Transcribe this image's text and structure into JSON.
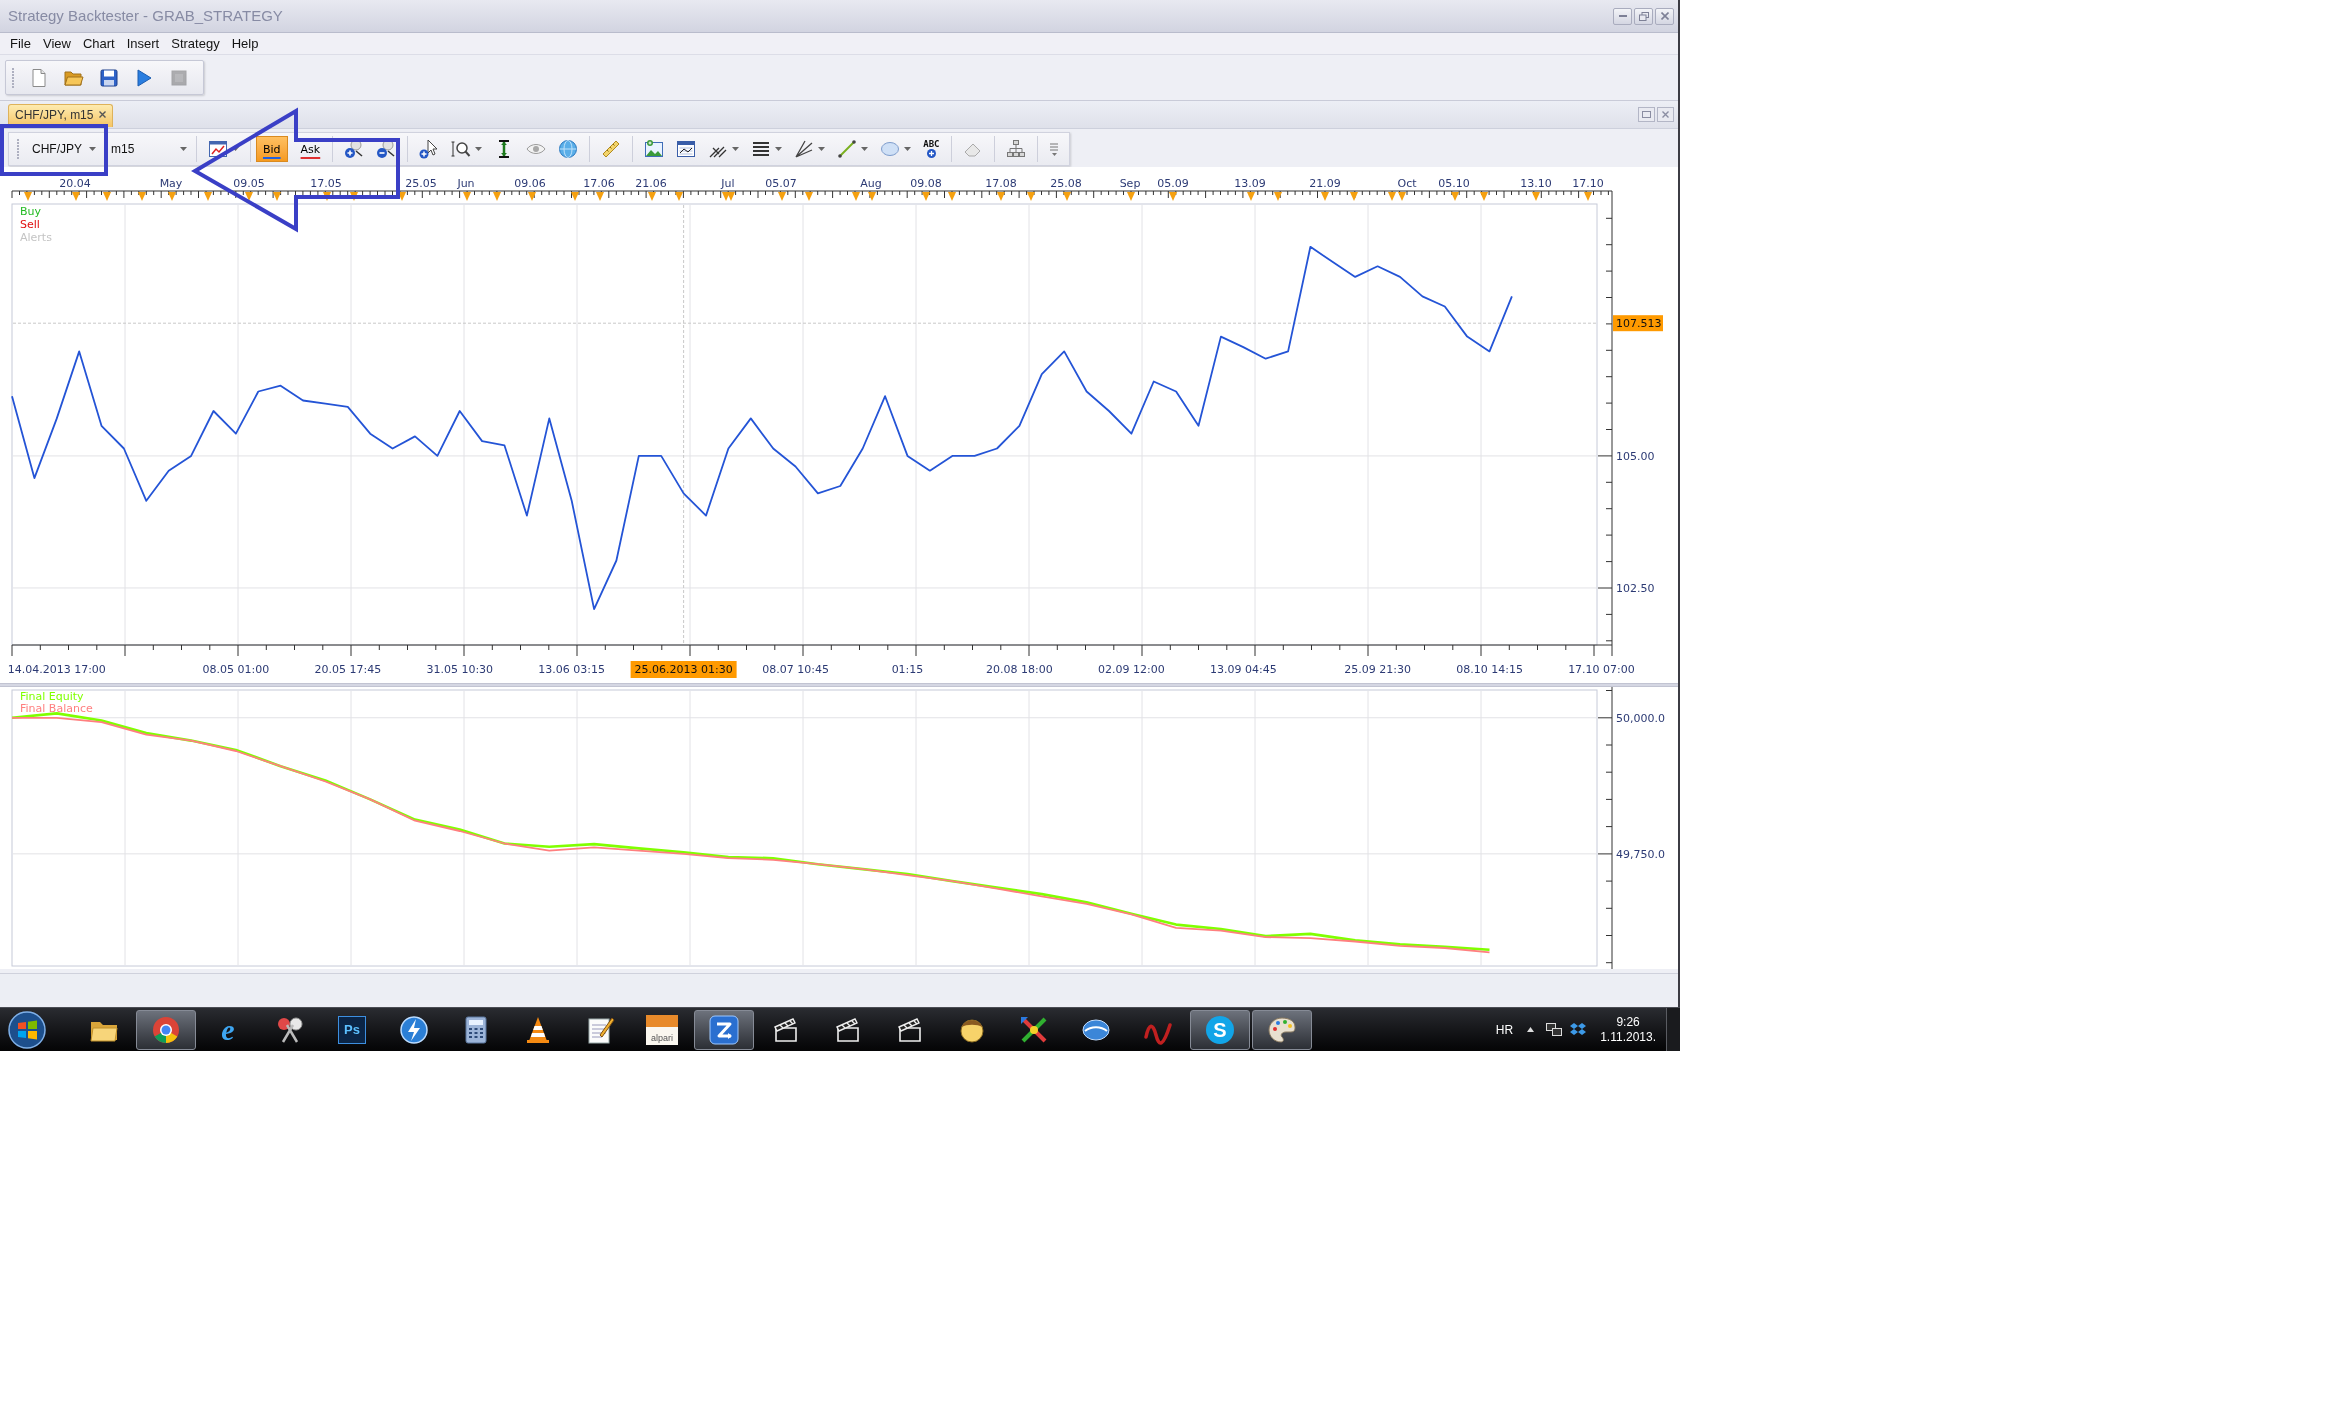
{
  "window": {
    "title": "Strategy Backtester - GRAB_STRATEGY"
  },
  "menu": [
    "File",
    "View",
    "Chart",
    "Insert",
    "Strategy",
    "Help"
  ],
  "toolbar": [
    {
      "kind": "new",
      "disabled": false
    },
    {
      "kind": "open",
      "disabled": false
    },
    {
      "kind": "save",
      "disabled": false
    },
    {
      "kind": "run",
      "disabled": false
    },
    {
      "kind": "stop",
      "disabled": true
    }
  ],
  "document_tab": {
    "label": "CHF/JPY, m15"
  },
  "chart_toolbar": {
    "symbol": "CHF/JPY",
    "period": "m15",
    "price_modes": [
      {
        "label": "Bid",
        "selected": true
      },
      {
        "label": "Ask",
        "selected": false
      }
    ],
    "text_tool": "ABC"
  },
  "price_chart": {
    "top_axis": [
      "20.04",
      "May",
      "09.05",
      "17.05",
      "25.05",
      "Jun",
      "09.06",
      "17.06",
      "21.06",
      "Jul",
      "05.07",
      "Aug",
      "09.08",
      "17.08",
      "25.08",
      "Sep",
      "05.09",
      "13.09",
      "21.09",
      "Oct",
      "05.10",
      "13.10",
      "17.10"
    ],
    "legend": [
      {
        "label": "Buy",
        "color": "#22bb22"
      },
      {
        "label": "Sell",
        "color": "#e01010"
      },
      {
        "label": "Alerts",
        "color": "#c4c4c4"
      }
    ],
    "chart_data": {
      "type": "line",
      "categories": [
        null,
        null,
        "14.04.2013 17:00",
        null,
        null,
        null,
        null,
        null,
        null,
        null,
        "08.05 01:00",
        null,
        null,
        null,
        null,
        "20.05 17:45",
        null,
        null,
        null,
        null,
        "31.05 10:30",
        null,
        null,
        null,
        null,
        "13.06 03:15",
        null,
        null,
        null,
        null,
        "25.06.2013 01:30",
        null,
        null,
        null,
        null,
        "08.07 10:45",
        null,
        null,
        null,
        null,
        "01:15",
        null,
        null,
        null,
        null,
        "20.08 18:00",
        null,
        null,
        null,
        null,
        "02.09 12:00",
        null,
        null,
        null,
        null,
        "13.09 04:45",
        null,
        null,
        null,
        null,
        null,
        "25.09 21:30",
        null,
        null,
        null,
        null,
        "08.10 14:15",
        null,
        null,
        null,
        null,
        "17.10 07:00"
      ],
      "values": [
        106.13,
        104.58,
        105.71,
        106.98,
        105.57,
        105.14,
        104.15,
        104.72,
        105,
        105.85,
        105.42,
        106.22,
        106.33,
        106.05,
        105.99,
        105.93,
        105.42,
        105.14,
        105.37,
        105,
        105.85,
        105.28,
        105.2,
        103.87,
        105.71,
        104.15,
        102.1,
        103.02,
        105,
        105,
        104.29,
        103.87,
        105.14,
        105.71,
        105.14,
        104.8,
        104.29,
        104.43,
        105.14,
        106.13,
        105,
        104.72,
        105,
        105,
        105.14,
        105.57,
        106.55,
        106.98,
        106.22,
        105.85,
        105.42,
        106.41,
        106.22,
        105.57,
        107.26,
        107.06,
        106.84,
        106.98,
        108.96,
        108.67,
        108.39,
        108.59,
        108.39,
        108.02,
        107.83,
        107.26,
        106.98,
        108.02,
        null,
        null,
        null,
        null
      ],
      "ylim": [
        101.42,
        109.77
      ],
      "yticks": [
        {
          "value": 102.5,
          "label": "102.50"
        },
        {
          "value": 105,
          "label": "105.00"
        }
      ],
      "grid": true,
      "ref_lines": [
        {
          "axis": "y",
          "value": 107.513,
          "label": "107.513"
        },
        {
          "axis": "x",
          "value": "25.06.2013 01:30"
        }
      ]
    }
  },
  "equity_chart": {
    "chart_data": {
      "type": "line",
      "categories": [
        null,
        null,
        null,
        null,
        null,
        null,
        null,
        null,
        null,
        null,
        null,
        null,
        null,
        null,
        null,
        null,
        null,
        null,
        null,
        null,
        null,
        null,
        null,
        null,
        null,
        null,
        null,
        null,
        null,
        null,
        null,
        null,
        null,
        null,
        null,
        null
      ],
      "series": [
        {
          "name": "Final Equity",
          "color": "#80ff00",
          "values": [
            50000,
            50008,
            49995,
            49972,
            49958,
            49941,
            49911,
            49885,
            49850,
            49813,
            49795,
            49769,
            49763,
            49768,
            49760,
            49753,
            49744,
            49742,
            49731,
            49722,
            49713,
            49700,
            49688,
            49676,
            49661,
            49640,
            49620,
            49612,
            49599,
            49603,
            49591,
            49584,
            49579,
            49574,
            null,
            null
          ]
        },
        {
          "name": "Final Balance",
          "color": "#ff7f7f",
          "values": [
            50000,
            50000,
            49992,
            49969,
            49958,
            49939,
            49911,
            49883,
            49850,
            49811,
            49792,
            49769,
            49756,
            49762,
            49756,
            49750,
            49742,
            49739,
            49731,
            49722,
            49711,
            49700,
            49686,
            49672,
            49658,
            49639,
            49614,
            49609,
            49597,
            49595,
            49589,
            49581,
            49577,
            49569,
            null,
            null
          ]
        }
      ],
      "ylim": [
        49544,
        50051
      ],
      "yticks": [
        {
          "value": 50000,
          "label": "50,000.0"
        },
        {
          "value": 49750,
          "label": "49,750.0"
        }
      ],
      "grid": true
    }
  },
  "taskbar": {
    "apps": [
      {
        "kind": "folder",
        "running": false
      },
      {
        "kind": "ring",
        "running": true
      },
      {
        "kind": "orbit",
        "running": false,
        "label": "e"
      },
      {
        "kind": "scissors",
        "running": false
      },
      {
        "kind": "tile",
        "running": false,
        "label": "Ps"
      },
      {
        "kind": "bolt",
        "running": false
      },
      {
        "kind": "calculator",
        "running": false
      },
      {
        "kind": "cone",
        "running": false
      },
      {
        "kind": "notepad",
        "running": false
      },
      {
        "kind": "chart-tile",
        "running": false,
        "label": "alpari"
      },
      {
        "kind": "swirl",
        "running": true
      },
      {
        "kind": "clapper",
        "running": false
      },
      {
        "kind": "clapper",
        "running": false
      },
      {
        "kind": "clapper",
        "running": false
      },
      {
        "kind": "mascot",
        "running": false
      },
      {
        "kind": "cross",
        "running": false
      },
      {
        "kind": "oval",
        "running": false
      },
      {
        "kind": "wave",
        "running": false
      },
      {
        "kind": "circle-letter",
        "running": true,
        "label": "S"
      },
      {
        "kind": "palette",
        "running": true
      }
    ],
    "tray": {
      "language": "HR",
      "time": "9:26",
      "date": "1.11.2013."
    }
  }
}
